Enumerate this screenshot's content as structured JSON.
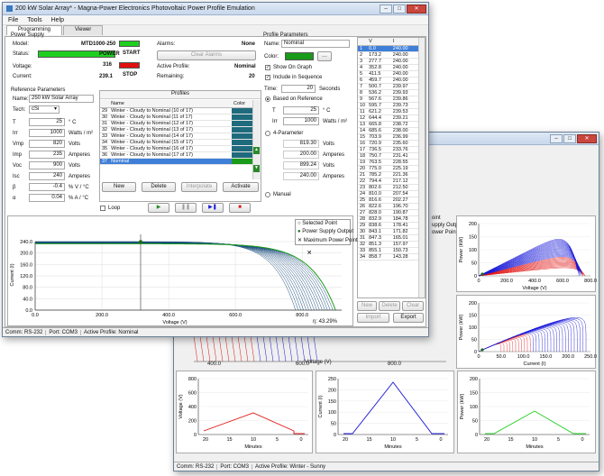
{
  "main": {
    "title": "200 kW Solar Array* - Magna-Power Electronics Photovoltaic Power Profile Emulation",
    "menu": [
      "File",
      "Tools",
      "Help"
    ],
    "tabs": [
      "Programming",
      "Viewer"
    ],
    "power_supply": {
      "header": "Power Supply",
      "model_label": "Model:",
      "model_value": "MTD1000-250",
      "status_label": "Status:",
      "status_value": "POWER",
      "voltage_label": "Voltage:",
      "voltage_value": "316",
      "current_label": "Current:",
      "current_value": "239.1",
      "start_label": "START",
      "stop_label": "STOP",
      "alarms_label": "Alarms:",
      "alarms_value": "None",
      "clear_alarms": "Clear Alarms",
      "active_profile_label": "Active Profile:",
      "active_profile_value": "Nominal",
      "remaining_label": "Remaining:",
      "remaining_value": "20"
    },
    "reference": {
      "header": "Reference Parameters",
      "name_label": "Name:",
      "name_value": "250 kW Solar Array",
      "tech_label": "Tech:",
      "tech_value": "cSi",
      "t_label": "T",
      "t_value": "25",
      "t_unit": "° C",
      "irr_label": "Irr",
      "irr_value": "1000",
      "irr_unit": "Watts / m²",
      "vmp_label": "Vmp",
      "vmp_value": "820",
      "vmp_unit": "Volts",
      "imp_label": "Imp",
      "imp_value": "235",
      "imp_unit": "Amperes",
      "voc_label": "Voc",
      "voc_value": "900",
      "voc_unit": "Volts",
      "isc_label": "Isc",
      "isc_value": "240",
      "isc_unit": "Amperes",
      "beta_label": "β",
      "beta_value": "-0.4",
      "beta_unit": "% V / °C",
      "alpha_label": "α",
      "alpha_value": "0.04",
      "alpha_unit": "% A / °C"
    },
    "profiles": {
      "header": "Profiles",
      "col_name": "Name",
      "col_color": "Color",
      "rows": [
        {
          "n": "29",
          "name": "Winter - Cloudy to Nominal (10 of 17)"
        },
        {
          "n": "30",
          "name": "Winter - Cloudy to Nominal (11 of 17)"
        },
        {
          "n": "31",
          "name": "Winter - Cloudy to Nominal (12 of 17)"
        },
        {
          "n": "32",
          "name": "Winter - Cloudy to Nominal (13 of 17)"
        },
        {
          "n": "33",
          "name": "Winter - Cloudy to Nominal (14 of 17)"
        },
        {
          "n": "34",
          "name": "Winter - Cloudy to Nominal (15 of 17)"
        },
        {
          "n": "35",
          "name": "Winter - Cloudy to Nominal (16 of 17)"
        },
        {
          "n": "36",
          "name": "Winter - Cloudy to Nominal (17 of 17)"
        },
        {
          "n": "37",
          "name": "Nominal"
        }
      ],
      "new": "New",
      "delete": "Delete",
      "interpolate": "Interpolate",
      "activate": "Activate",
      "loop": "Loop"
    },
    "profile_params": {
      "header": "Profile Parameters",
      "name_label": "Name:",
      "name_value": "Nominal",
      "color_label": "Color:",
      "show_on_graph": "Show On Graph",
      "include_seq": "Include in Sequence",
      "time_label": "Time:",
      "time_value": "20",
      "time_unit": "Seconds",
      "based_on_ref": "Based on Reference",
      "t_label": "T",
      "t_value": "25",
      "t_unit": "° C",
      "irr_label": "Irr",
      "irr_value": "1000",
      "irr_unit": "Watts / m²",
      "four_param": "4-Parameter",
      "vmp_value": "819.30",
      "vmp_unit": "Volts",
      "imp_value": "200.00",
      "imp_unit": "Amperes",
      "voc_value": "899.24",
      "voc_unit": "Volts",
      "isc_value": "240.00",
      "isc_unit": "Amperes",
      "manual": "Manual"
    },
    "vi_table": {
      "col_v": "V",
      "col_i": "I",
      "rows": [
        [
          "1",
          "0.0",
          "240.00"
        ],
        [
          "2",
          "173.2",
          "240.00"
        ],
        [
          "3",
          "277.7",
          "240.00"
        ],
        [
          "4",
          "352.8",
          "240.00"
        ],
        [
          "5",
          "411.5",
          "240.00"
        ],
        [
          "6",
          "459.7",
          "240.00"
        ],
        [
          "7",
          "500.7",
          "239.97"
        ],
        [
          "8",
          "536.2",
          "239.93"
        ],
        [
          "9",
          "567.6",
          "239.86"
        ],
        [
          "10",
          "595.7",
          "239.73"
        ],
        [
          "11",
          "621.2",
          "239.53"
        ],
        [
          "12",
          "644.4",
          "239.21"
        ],
        [
          "13",
          "665.8",
          "238.72"
        ],
        [
          "14",
          "685.6",
          "238.00"
        ],
        [
          "15",
          "703.9",
          "236.99"
        ],
        [
          "16",
          "720.9",
          "235.60"
        ],
        [
          "17",
          "736.5",
          "233.76"
        ],
        [
          "18",
          "750.7",
          "231.41"
        ],
        [
          "19",
          "763.5",
          "228.55"
        ],
        [
          "20",
          "775.0",
          "225.19"
        ],
        [
          "21",
          "785.2",
          "221.36"
        ],
        [
          "22",
          "794.4",
          "217.12"
        ],
        [
          "23",
          "802.6",
          "212.50"
        ],
        [
          "24",
          "810.0",
          "207.54"
        ],
        [
          "25",
          "816.6",
          "202.27"
        ],
        [
          "26",
          "822.6",
          "196.70"
        ],
        [
          "27",
          "828.0",
          "190.87"
        ],
        [
          "28",
          "832.9",
          "184.78"
        ],
        [
          "29",
          "838.6",
          "178.41"
        ],
        [
          "30",
          "843.1",
          "171.82"
        ],
        [
          "31",
          "847.3",
          "165.01"
        ],
        [
          "32",
          "851.3",
          "157.97"
        ],
        [
          "33",
          "855.1",
          "150.73"
        ],
        [
          "34",
          "858.7",
          "143.28"
        ]
      ],
      "new": "New",
      "delete": "Delete",
      "clear": "Clear",
      "import": "Import",
      "export": "Export"
    },
    "plot": {
      "legend": [
        "Selected Point",
        "Power Supply Output",
        "Maximum Power Point"
      ],
      "y_label": "Current (I)",
      "x_label": "Voltage (V)",
      "y_ticks": [
        "240.0",
        "200.0",
        "160.0",
        "120.0",
        "80.0",
        "40.0",
        "0.0"
      ],
      "x_ticks": [
        "0.0",
        "200.0",
        "400.0",
        "600.0",
        "800.0"
      ],
      "readout": "η: 43.29%"
    },
    "statusbar": {
      "comm": "Comm: RS-232",
      "port": "Port: COM3",
      "active": "Active Profile: Nominal"
    }
  },
  "viewer": {
    "legend_partial": [
      "oint",
      "upply Output",
      "ower Point"
    ],
    "pv_y_label": "Power (kW)",
    "pv_x_label": "Voltage (V)",
    "pi_y_label": "Power (kW)",
    "pi_x_label": "Current (I)",
    "pv_y_ticks": [
      "200",
      "150",
      "100",
      "50",
      "0"
    ],
    "pv_x_ticks": [
      "0",
      "200.0",
      "400.0",
      "600.0",
      "800.0"
    ],
    "pi_x_ticks": [
      "0",
      "50.0",
      "100.0",
      "150.0",
      "200.0",
      "250.0"
    ],
    "iv_x_label": "Voltage (V)",
    "iv_x_ticks": [
      "400.0",
      "600.0",
      "800.0"
    ],
    "time_v_y_label": "Voltage (V)",
    "time_i_y_label": "Current (I)",
    "time_p_y_label": "Power (kW)",
    "time_x_label": "Minutes",
    "time_v_ticks": [
      "800",
      "600",
      "400",
      "200",
      "0"
    ],
    "time_i_ticks": [
      "250",
      "200",
      "150",
      "100",
      "50",
      "0"
    ],
    "time_p_ticks": [
      "200",
      "150",
      "100",
      "50",
      "0"
    ],
    "minutes_ticks": [
      "20",
      "15",
      "10",
      "5",
      "0"
    ],
    "statusbar": {
      "comm": "Comm: RS-232",
      "port": "Port: COM3",
      "active": "Active Profile: Winter - Sunny"
    }
  },
  "colors": {
    "green": "#1fcf1f",
    "red": "#e01010",
    "blue": "#1717d8",
    "dark_green": "#1a6e1a",
    "profile_color": "#1f6b7d"
  }
}
